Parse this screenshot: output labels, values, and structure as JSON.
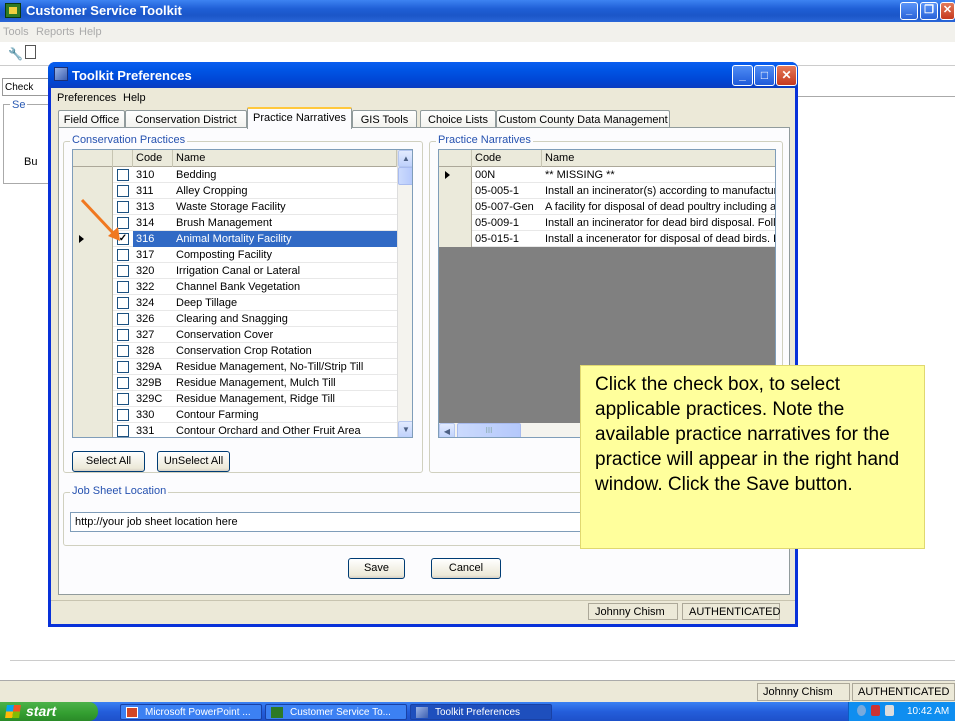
{
  "app": {
    "title": "Customer Service Toolkit",
    "menu": [
      "Tools",
      "Reports",
      "Help"
    ],
    "behind_tab": "Check",
    "behind_group_label": "Se",
    "behind_button": "Bu",
    "status": {
      "user": "Johnny Chism",
      "auth": "AUTHENTICATED"
    }
  },
  "dialog": {
    "title": "Toolkit Preferences",
    "menu": [
      "Preferences",
      "Help"
    ],
    "tabs": [
      "Field Office",
      "Conservation District",
      "Practice Narratives",
      "GIS Tools",
      "Choice Lists",
      "Custom County Data Management"
    ],
    "active_tab": "Practice Narratives",
    "practices": {
      "label": "Conservation Practices",
      "headers": [
        "Code",
        "Name"
      ],
      "rows": [
        {
          "code": "310",
          "name": "Bedding",
          "checked": false
        },
        {
          "code": "311",
          "name": "Alley Cropping",
          "checked": false
        },
        {
          "code": "313",
          "name": "Waste Storage Facility",
          "checked": false
        },
        {
          "code": "314",
          "name": "Brush Management",
          "checked": false
        },
        {
          "code": "316",
          "name": "Animal Mortality Facility",
          "checked": true,
          "selected": true
        },
        {
          "code": "317",
          "name": "Composting Facility",
          "checked": false
        },
        {
          "code": "320",
          "name": "Irrigation Canal or Lateral",
          "checked": false
        },
        {
          "code": "322",
          "name": "Channel Bank Vegetation",
          "checked": false
        },
        {
          "code": "324",
          "name": "Deep Tillage",
          "checked": false
        },
        {
          "code": "326",
          "name": "Clearing and Snagging",
          "checked": false
        },
        {
          "code": "327",
          "name": "Conservation Cover",
          "checked": false
        },
        {
          "code": "328",
          "name": "Conservation Crop Rotation",
          "checked": false
        },
        {
          "code": "329A",
          "name": "Residue Management, No-Till/Strip Till",
          "checked": false
        },
        {
          "code": "329B",
          "name": "Residue Management, Mulch Till",
          "checked": false
        },
        {
          "code": "329C",
          "name": "Residue Management, Ridge Till",
          "checked": false
        },
        {
          "code": "330",
          "name": "Contour Farming",
          "checked": false
        },
        {
          "code": "331",
          "name": "Contour Orchard and Other Fruit Area",
          "checked": false
        }
      ],
      "select_all": "Select All",
      "unselect_all": "UnSelect All"
    },
    "narratives": {
      "label": "Practice Narratives",
      "headers": [
        "Code",
        "Name"
      ],
      "rows": [
        {
          "code": "00N",
          "name": "** MISSING **"
        },
        {
          "code": "05-005-1",
          "name": "Install an incinerator(s) according to manufacturers"
        },
        {
          "code": "05-007-Gen",
          "name": "A facility for disposal of dead poultry including an i"
        },
        {
          "code": "05-009-1",
          "name": "Install an incinerator for dead bird disposal.  Follo"
        },
        {
          "code": "05-015-1",
          "name": "Install a incenerator for disposal of dead birds. Fo"
        }
      ],
      "scroll_thumb_text": "III"
    },
    "job_sheet": {
      "label": "Job Sheet Location",
      "value": "http://your job sheet location here"
    },
    "save": "Save",
    "cancel": "Cancel",
    "status": {
      "user": "Johnny Chism",
      "auth": "AUTHENTICATED"
    }
  },
  "callout": "Click the check box, to select applicable practices. Note the available practice narratives for the practice will appear in the right hand window. Click the Save button.",
  "taskbar": {
    "start": "start",
    "items": [
      "Microsoft PowerPoint ...",
      "Customer Service To...",
      "Toolkit Preferences"
    ],
    "clock": "10:42 AM"
  },
  "colors": {
    "selection": "#316ac5",
    "callout_bg": "#ffff9c",
    "titlebar": "#0055e5",
    "arrow": "#f07820"
  }
}
